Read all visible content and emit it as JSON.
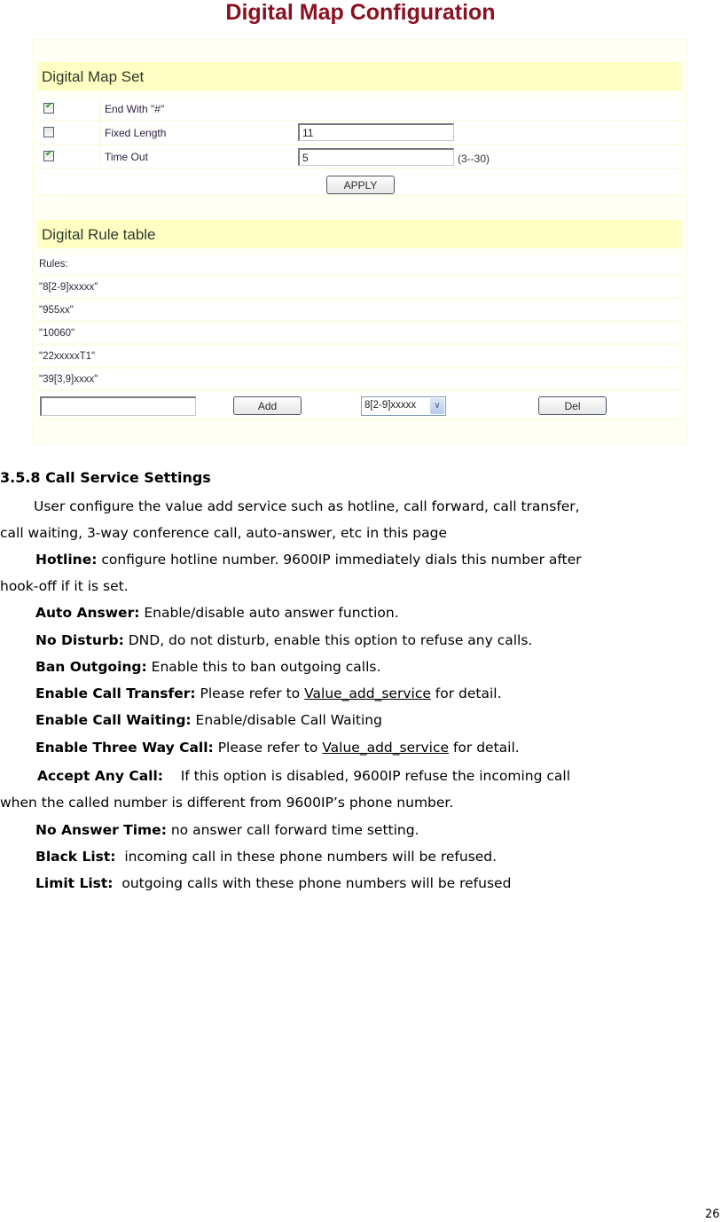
{
  "figure": {
    "title": "Digital Map Configuration",
    "map_set": {
      "heading": "Digital Map Set",
      "rows": [
        {
          "label": "End With \"#\"",
          "checked": true
        },
        {
          "label": "Fixed Length",
          "checked": false,
          "value": "11"
        },
        {
          "label": "Time Out",
          "checked": true,
          "value": "5",
          "hint": "(3--30)"
        }
      ],
      "apply_label": "APPLY"
    },
    "rule_table": {
      "heading": "Digital Rule table",
      "rules_label": "Rules:",
      "rules": [
        "\"8[2-9]xxxxx\"",
        "\"955xx\"",
        "\"10060\"",
        "\"22xxxxxT1\"",
        "\"39[3,9]xxxx\""
      ],
      "new_rule_value": "",
      "add_label": "Add",
      "selected_rule": "8[2-9]xxxxx",
      "del_label": "Del"
    }
  },
  "section": {
    "heading": "3.5.8 Call Service Settings",
    "intro_line1": "User configure the value add service such as hotline, call forward, call transfer,",
    "intro_line2": "call waiting, 3-way conference call, auto-answer, etc in this page",
    "items": [
      {
        "term": "Hotline:",
        "desc": " configure hotline number. 9600IP immediately dials this number after",
        "cont": "hook-off if it is set."
      },
      {
        "term": "Auto Answer:",
        "desc": " Enable/disable auto answer function."
      },
      {
        "term": "No Disturb:",
        "desc": " DND, do not disturb, enable this option to refuse any calls."
      },
      {
        "term": "Ban Outgoing:",
        "desc": " Enable this to ban outgoing calls."
      },
      {
        "term": "Enable Call Transfer:",
        "pre": " Please refer to ",
        "link": "Value_add_service",
        "post": " for detail."
      },
      {
        "term": "Enable Call Waiting:",
        "desc": " Enable/disable Call Waiting"
      },
      {
        "term": "Enable Three Way Call:",
        "pre": " Please refer to ",
        "link": "Value_add_service",
        "post": " for detail."
      },
      {
        "term": "Accept Any Call:",
        "desc": "    If this option is disabled, 9600IP refuse the incoming call",
        "cont": "when the called number is different from 9600IP’s phone number."
      },
      {
        "term": "No Answer Time:",
        "desc": " no answer call forward time setting."
      },
      {
        "term": "Black List:",
        "desc": "  incoming call in these phone numbers will be refused."
      },
      {
        "term": "Limit List:",
        "desc": "  outgoing calls with these phone numbers will be refused"
      }
    ]
  },
  "page_number": "26"
}
